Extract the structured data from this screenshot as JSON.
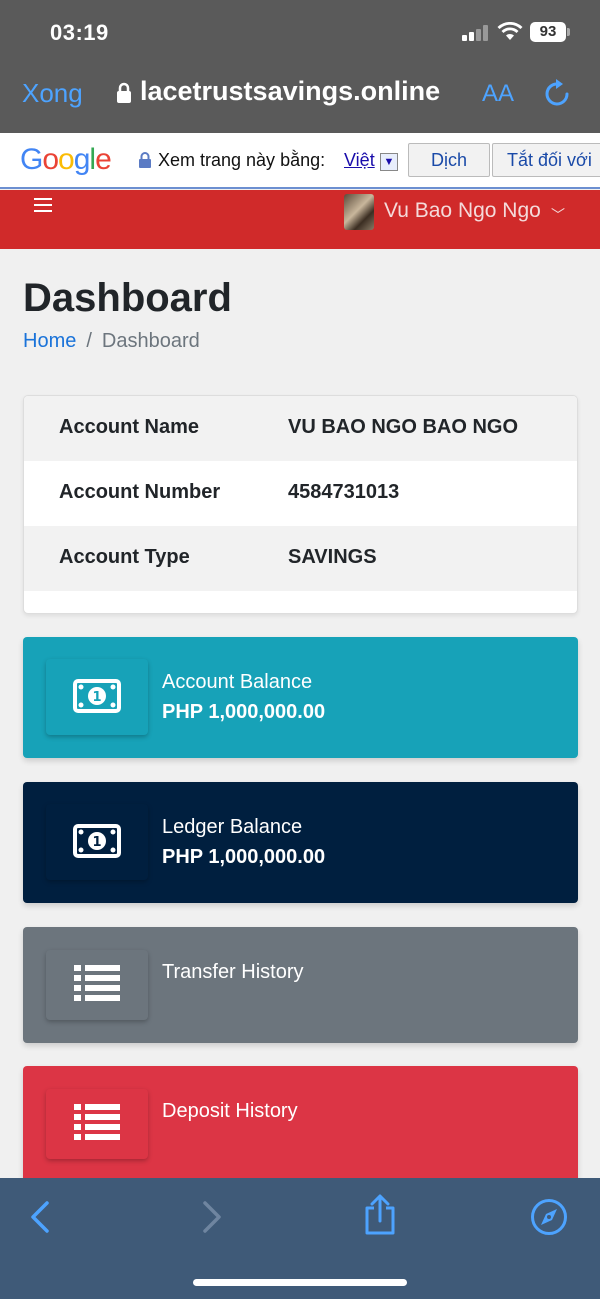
{
  "status_bar": {
    "time": "03:19",
    "battery": "93"
  },
  "safari": {
    "done_label": "Xong",
    "url": "lacetrustsavings.online",
    "text_size_label": "AA"
  },
  "translate_bar": {
    "logo": "Google",
    "prompt": "Xem trang này bằng:",
    "language": "Việt",
    "translate_button": "Dịch",
    "turn_off_button": "Tắt đối với"
  },
  "header": {
    "user_name": "Vu Bao Ngo Ngo"
  },
  "page": {
    "title": "Dashboard",
    "breadcrumb": {
      "home": "Home",
      "separator": "/",
      "current": "Dashboard"
    }
  },
  "account": {
    "rows": [
      {
        "label": "Account Name",
        "value": "VU BAO NGO BAO NGO"
      },
      {
        "label": "Account Number",
        "value": "4584731013"
      },
      {
        "label": "Account Type",
        "value": "SAVINGS"
      }
    ]
  },
  "tiles": {
    "balance": {
      "label": "Account Balance",
      "value": "PHP 1,000,000.00",
      "color": "#17a2b8"
    },
    "ledger": {
      "label": "Ledger Balance",
      "value": "PHP 1,000,000.00",
      "color": "#001f3f"
    },
    "transfer": {
      "label": "Transfer History",
      "color": "#6c757d"
    },
    "deposit": {
      "label": "Deposit History",
      "color": "#dc3545"
    }
  },
  "colors": {
    "header_red": "#d02a2a",
    "link_blue": "#1a73d9",
    "safari_blue": "#4da3ff"
  }
}
